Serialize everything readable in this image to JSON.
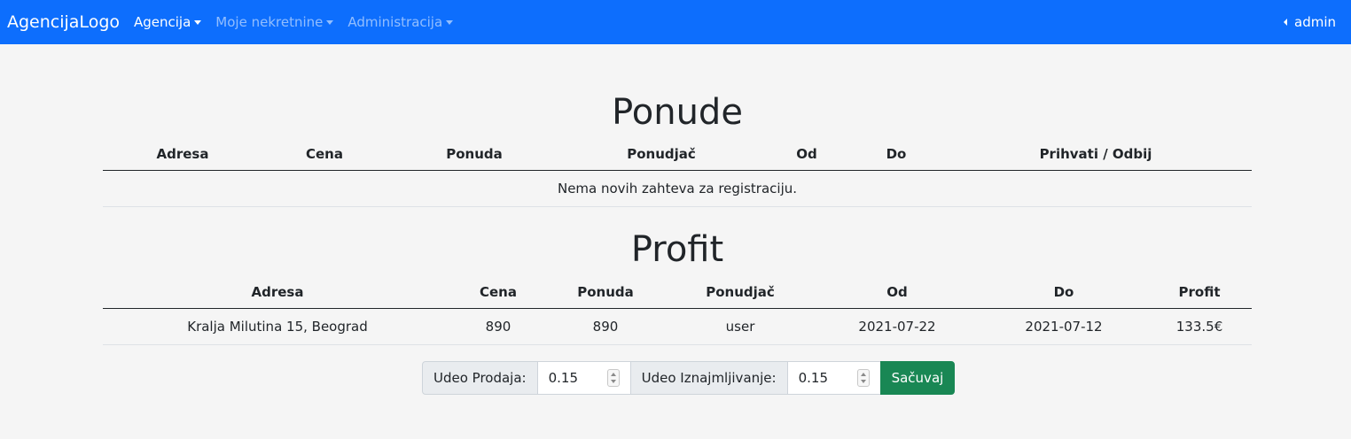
{
  "navbar": {
    "brand": "AgencijaLogo",
    "items": [
      {
        "label": "Agencija"
      },
      {
        "label": "Moje nekretnine"
      },
      {
        "label": "Administracija"
      }
    ],
    "user": "admin"
  },
  "ponude": {
    "title": "Ponude",
    "columns": [
      "Adresa",
      "Cena",
      "Ponuda",
      "Ponudjač",
      "Od",
      "Do",
      "Prihvati / Odbij"
    ],
    "empty_message": "Nema novih zahteva za registraciju."
  },
  "profit": {
    "title": "Profit",
    "columns": [
      "Adresa",
      "Cena",
      "Ponuda",
      "Ponudjač",
      "Od",
      "Do",
      "Profit"
    ],
    "rows": [
      [
        "Kralja Milutina 15, Beograd",
        "890",
        "890",
        "user",
        "2021-07-22",
        "2021-07-12",
        "133.5€"
      ]
    ]
  },
  "form": {
    "prodaja_label": "Udeo Prodaja:",
    "prodaja_value": "0.15",
    "iznajmljivanje_label": "Udeo Iznajmljivanje:",
    "iznajmljivanje_value": "0.15",
    "save_label": "Sačuvaj"
  },
  "colors": {
    "navbar": "#0d6efd",
    "save_button": "#198754",
    "background": "#f5f5f5"
  }
}
